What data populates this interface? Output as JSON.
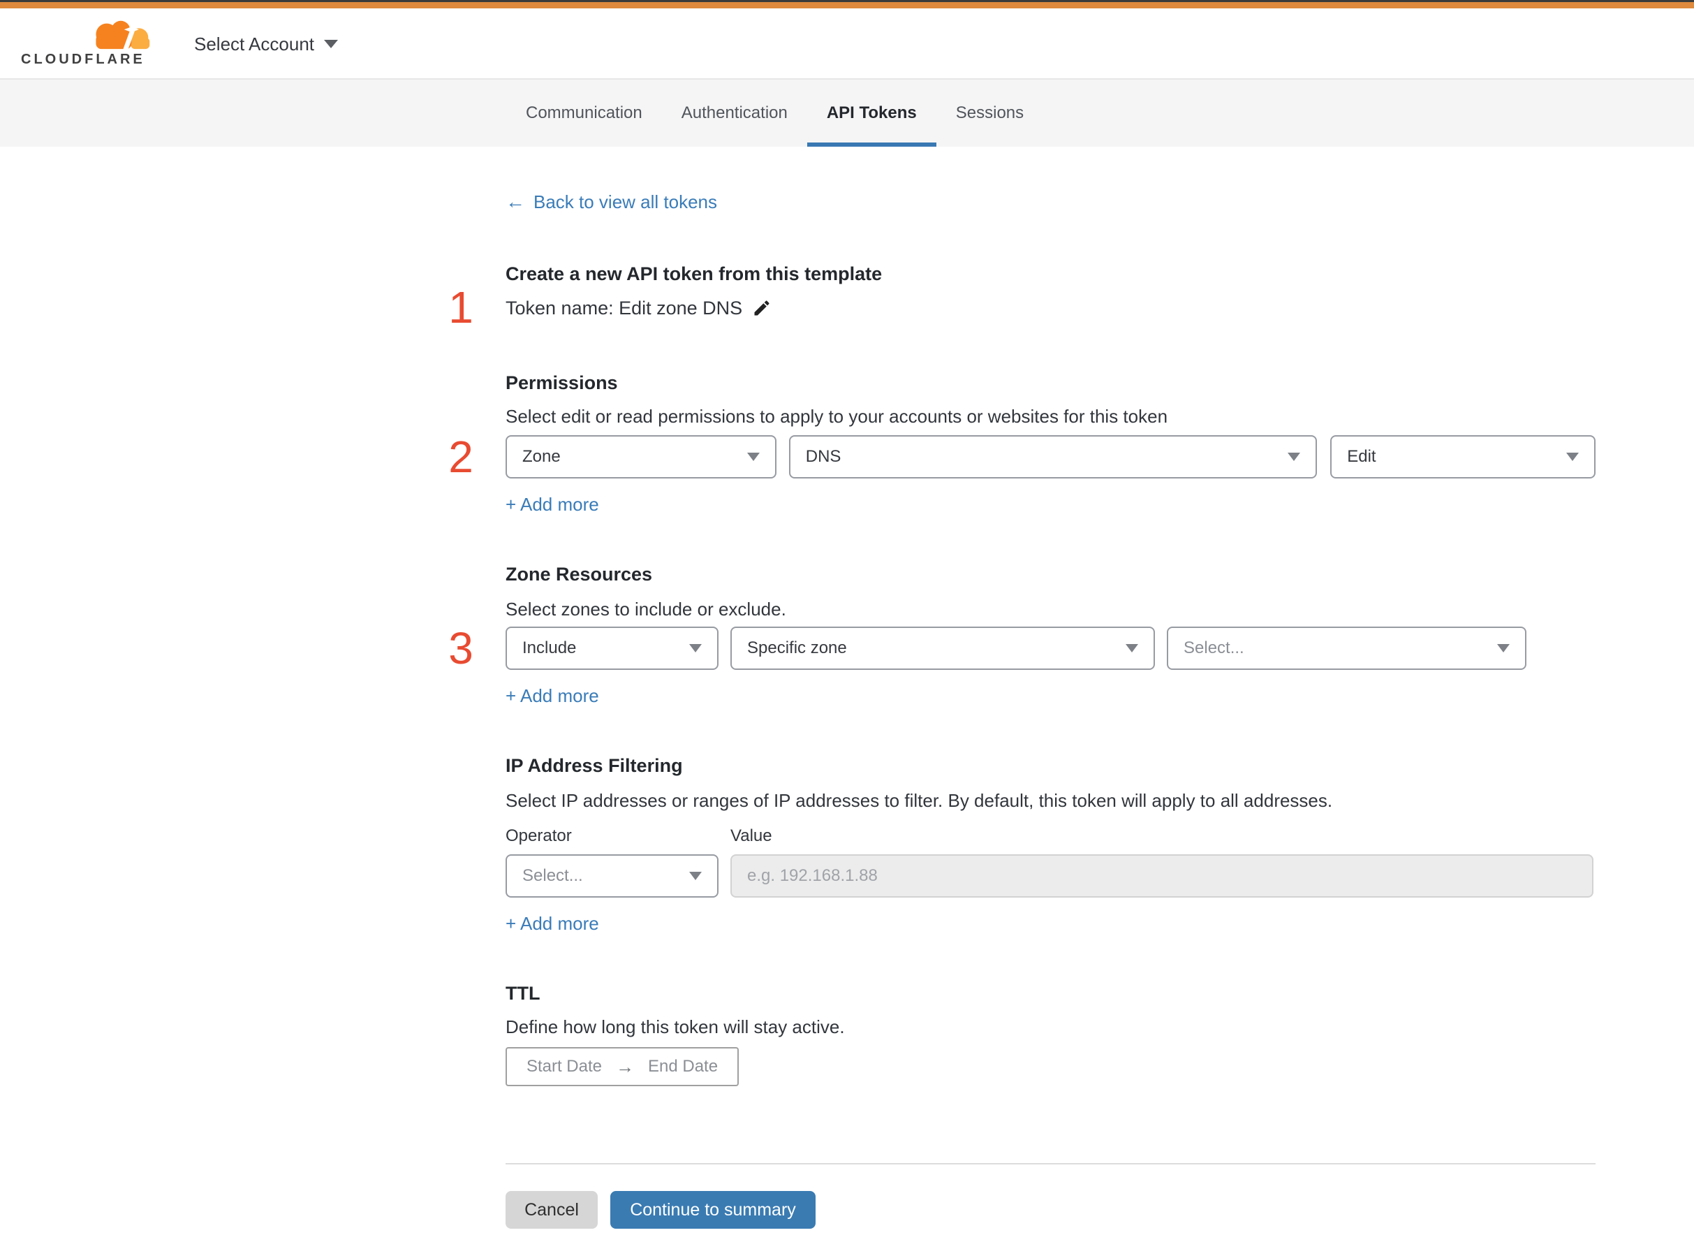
{
  "header": {
    "wordmark": "CLOUDFLARE",
    "account_selector": "Select Account"
  },
  "tabs": {
    "items": [
      {
        "label": "Communication",
        "active": false
      },
      {
        "label": "Authentication",
        "active": false
      },
      {
        "label": "API Tokens",
        "active": true
      },
      {
        "label": "Sessions",
        "active": false
      }
    ]
  },
  "content": {
    "back_link": "Back to view all tokens",
    "back_arrow": "←",
    "title": "Create a new API token from this template",
    "token_name": "Token name: Edit zone DNS",
    "steps": {
      "one": "1",
      "two": "2",
      "three": "3"
    },
    "permissions": {
      "heading": "Permissions",
      "description": "Select edit or read permissions to apply to your accounts or websites for this token",
      "scope_value": "Zone",
      "resource_value": "DNS",
      "access_value": "Edit",
      "add_more": "+ Add more"
    },
    "zone_resources": {
      "heading": "Zone Resources",
      "description": "Select zones to include or exclude.",
      "mode_value": "Include",
      "type_value": "Specific zone",
      "zone_placeholder": "Select...",
      "add_more": "+ Add more"
    },
    "ip_filtering": {
      "heading": "IP Address Filtering",
      "description": "Select IP addresses or ranges of IP addresses to filter. By default, this token will apply to all addresses.",
      "operator_label": "Operator",
      "value_label": "Value",
      "operator_placeholder": "Select...",
      "value_placeholder": "e.g. 192.168.1.88",
      "add_more": "+ Add more"
    },
    "ttl": {
      "heading": "TTL",
      "description": "Define how long this token will stay active.",
      "start_date": "Start Date",
      "arrow": "→",
      "end_date": "End Date"
    }
  },
  "footer": {
    "cancel": "Cancel",
    "continue_label": "Continue to summary"
  },
  "colors": {
    "top_bar_orange": "#df8a3d",
    "brand_orange": "#f6821f",
    "brand_orange_light": "#fbad41",
    "link_blue": "#3a7cb8",
    "button_blue": "#3a7bb2",
    "tab_underline_blue": "#3978b3",
    "step_number_red": "#e84b31",
    "tab_strip_gray": "#f5f5f6"
  }
}
